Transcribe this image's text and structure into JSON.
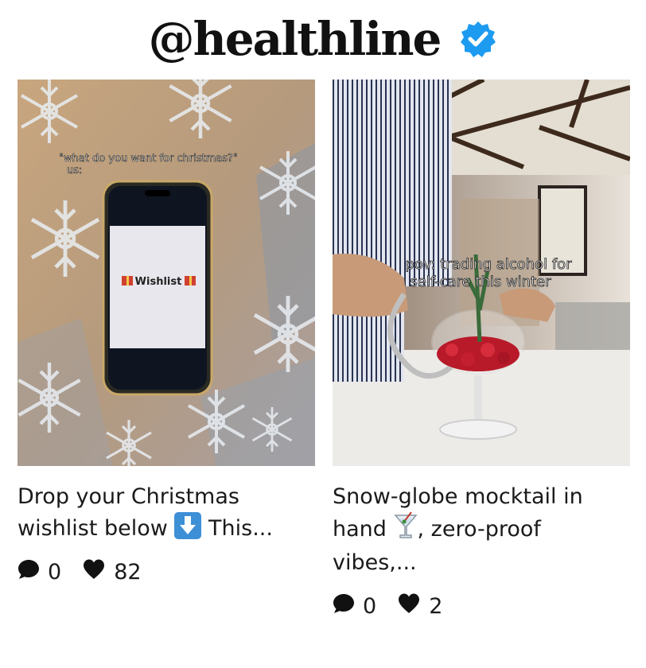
{
  "header": {
    "handle": "@healthline"
  },
  "posts": [
    {
      "overlay_top": "\"what do you want for christmas?\"",
      "overlay_us": "us:",
      "screen_text": "Wishlist",
      "caption_a": "Drop your Christmas",
      "caption_b": "wishlist below",
      "caption_c": " This...",
      "comments": "0",
      "likes": "82"
    },
    {
      "overlay_line1": "pov: trading alcohol for",
      "overlay_line2": "self-care this winter",
      "caption_a": "Snow-globe mocktail in",
      "caption_b": "hand",
      "caption_c": ", zero-proof",
      "caption_d": "vibes,...",
      "comments": "0",
      "likes": "2"
    }
  ],
  "colors": {
    "verified": "#1d9bf0",
    "emoji_box": "#3d8fd6"
  },
  "icons": [
    "verified-badge-icon",
    "comment-icon",
    "heart-icon",
    "down-arrow-emoji-icon",
    "cocktail-emoji-icon",
    "gift-icon"
  ]
}
